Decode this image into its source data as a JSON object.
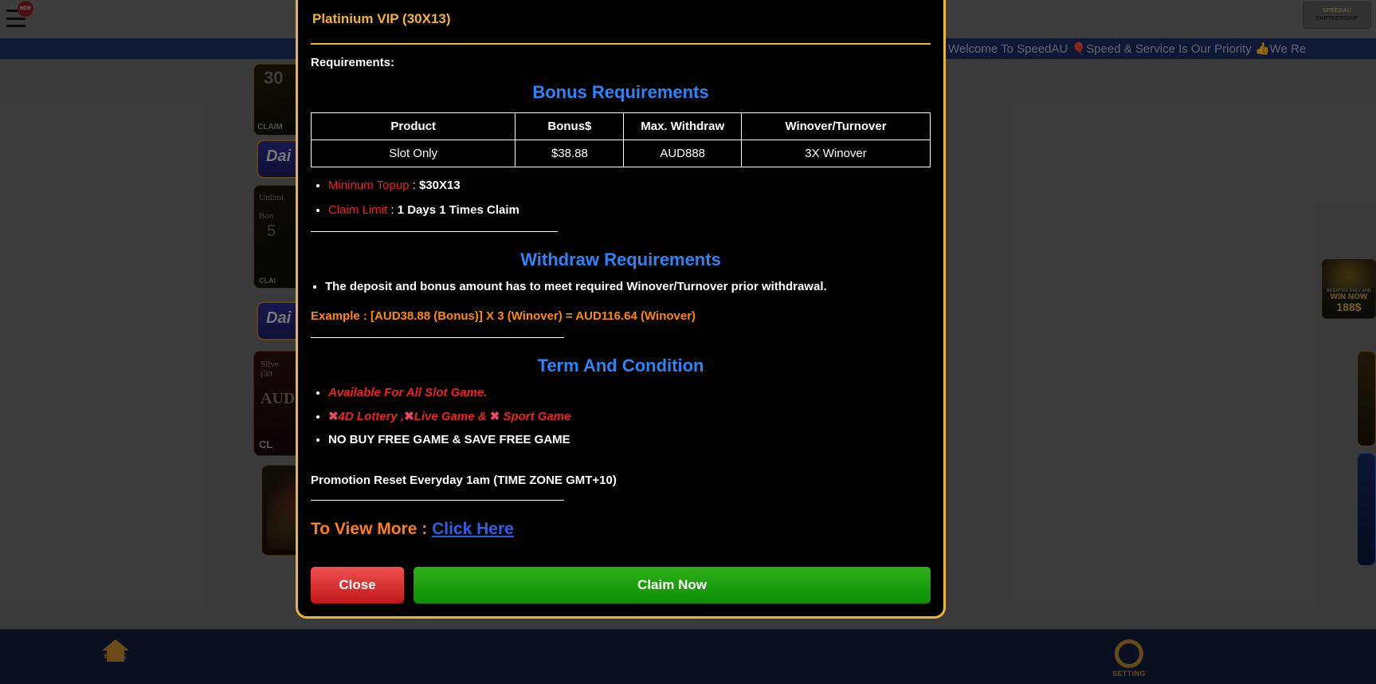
{
  "background": {
    "menu_badge": "NEW",
    "partner_logo_line1": "SPEEDAU",
    "partner_logo_line2": "PARTNERSHIP",
    "marquee_text": "Welcome To SpeedAU 🎈Speed & Service Is Our Priority 👍We Re",
    "cards": {
      "card1_number": "30",
      "card1_claim": "CLAIM",
      "card2_label": "Dai",
      "card3_line1": "Unlimi",
      "card3_line2": "Bon",
      "card3_big": "5",
      "card3_claim": "CLAI",
      "card4_label": "Dai",
      "card5_line1": "Silve",
      "card5_line2": "(30",
      "card5_amount": "AUD",
      "card5_claim": "CL"
    },
    "float_widgets": {
      "w1_register": "REGISTER ONLY AND",
      "w1_win": "WIN NOW",
      "w1_amount": "188$"
    },
    "bottom_nav": [
      {
        "label": "HOME",
        "icon": "home-icon"
      },
      {
        "label": "SETTING",
        "icon": "gear-icon"
      }
    ]
  },
  "modal": {
    "title": "Platinium VIP (30X13)",
    "requirements_label": "Requirements:",
    "bonus_section_title": "Bonus Requirements",
    "table": {
      "headers": [
        "Product",
        "Bonus$",
        "Max. Withdraw",
        "Winover/Turnover"
      ],
      "rows": [
        [
          "Slot Only",
          "$38.88",
          "AUD888",
          "3X Winover"
        ]
      ]
    },
    "requirement_items": [
      {
        "label": "Mininum Topup",
        "separator": " : ",
        "value": "$30X13"
      },
      {
        "label": "Claim Limit",
        "separator": " : ",
        "value": "1 Days 1 Times Claim"
      }
    ],
    "withdraw_section_title": "Withdraw Requirements",
    "withdraw_bullet": "The deposit and bonus amount has to meet required Winover/Turnover prior withdrawal.",
    "example_line": "Example : [AUD38.88 (Bonus)] X 3 (Winover) = AUD116.64 (Winover)",
    "terms_section_title": "Term And Condition",
    "terms": {
      "item1": "Available For All Slot Game.",
      "item2_x1": "✖",
      "item2_p1": "4D Lottery ,",
      "item2_x2": "✖",
      "item2_p2": "Live Game & ",
      "item2_x3": "✖",
      "item2_p3": " Sport Game",
      "item3": "NO BUY FREE GAME & SAVE FREE GAME"
    },
    "promotion_reset": "Promotion Reset Everyday 1am (TIME ZONE GMT+10)",
    "view_more_label": "To View More : ",
    "view_more_link": "Click Here",
    "close_button": "Close",
    "claim_button": "Claim Now"
  },
  "colors": {
    "modal_border": "#e8b737",
    "title": "#f0b62a",
    "section_heading": "#2f84f5",
    "red_label": "#ee2222",
    "orange_example": "#ff8a00",
    "link_blue": "#2f5fe8",
    "close_btn": "#d02020",
    "claim_btn": "#17a010"
  }
}
